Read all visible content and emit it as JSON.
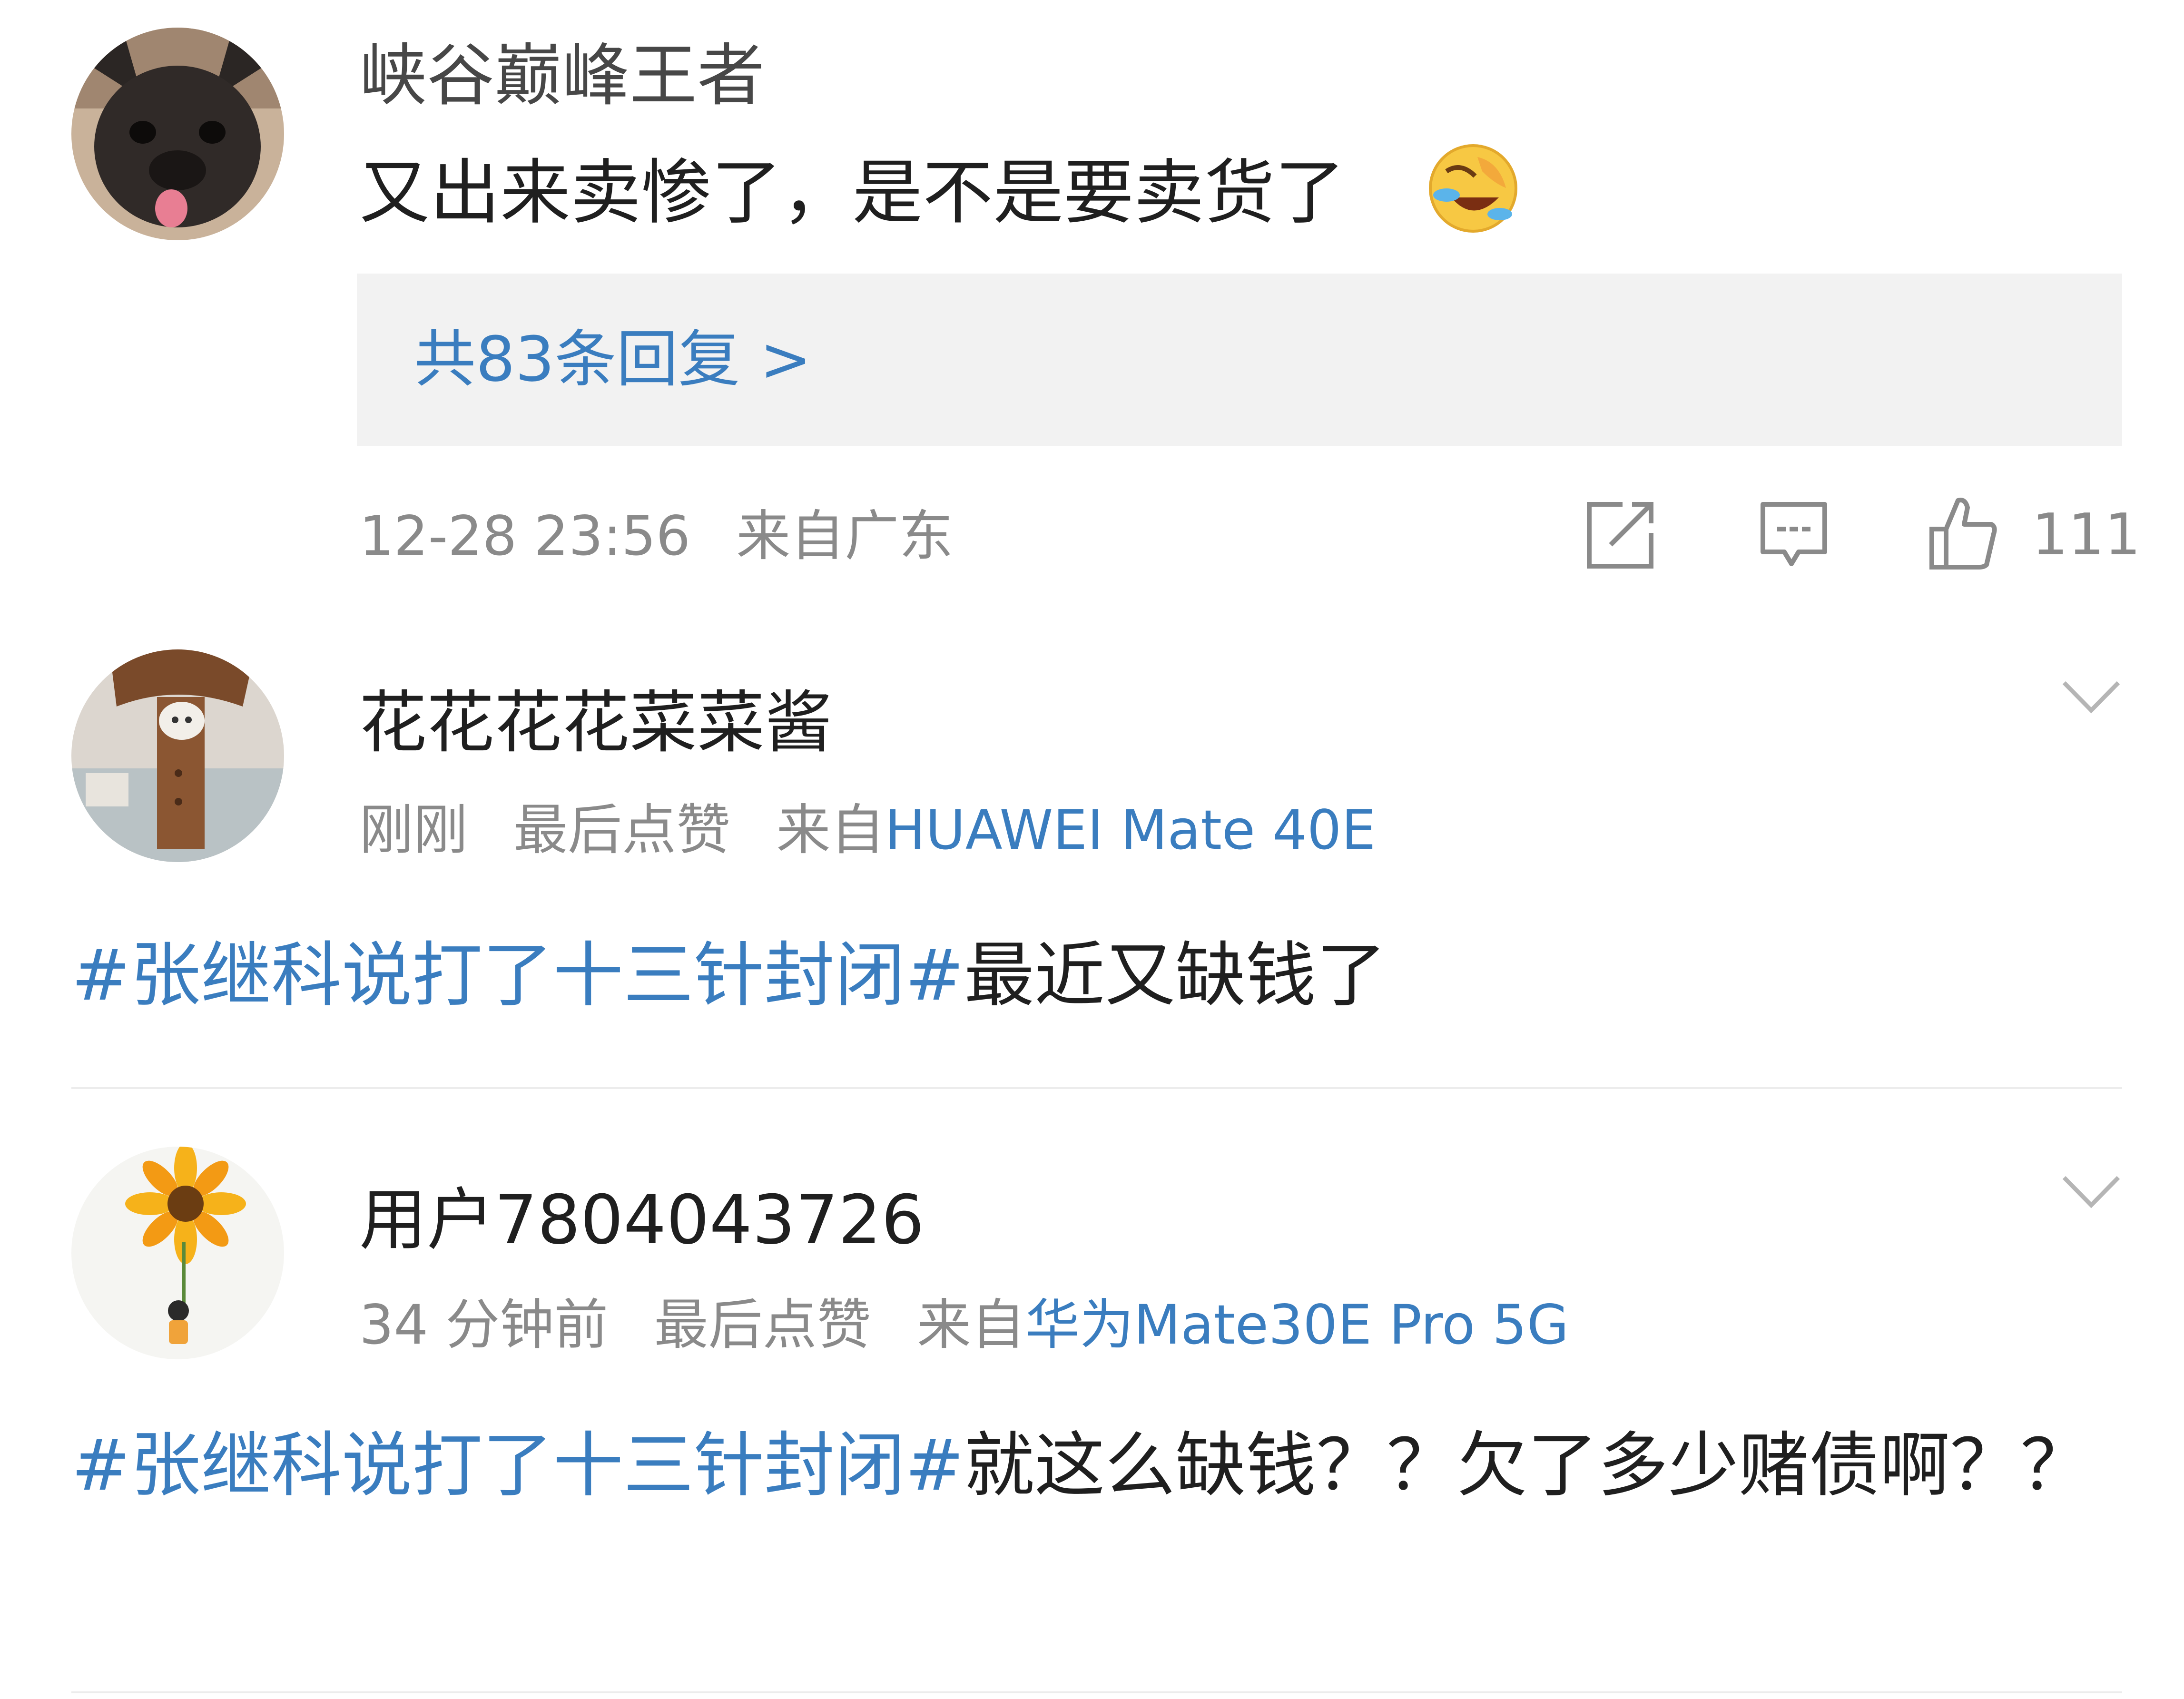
{
  "comments": [
    {
      "username": "峡谷巅峰王者",
      "avatar": "french-bulldog-photo",
      "text": "又出来卖惨了，是不是要卖货了",
      "emoji": "laughing-crying-emoji",
      "replies_label": "共83条回复 >",
      "time": "12-28 23:56",
      "location": "来自广东",
      "icons": [
        "share-icon",
        "comment-icon",
        "like-icon"
      ],
      "like_count": "111"
    },
    {
      "username": "花花花花菜菜酱",
      "avatar": "cat-on-chair-photo",
      "time": "刚刚",
      "last_liked": "最后点赞",
      "from_label": "来自",
      "device": "HUAWEI Mate 40E",
      "topic": "#张继科说打了十三针封闭#",
      "text": "最近又缺钱了",
      "menu_icon": "chevron-down-icon"
    },
    {
      "username": "用户7804043726",
      "avatar": "sunflower-illustration",
      "time": "34 分钟前",
      "last_liked": "最后点赞",
      "from_label": "来自",
      "device": "华为Mate30E Pro 5G",
      "topic": "#张继科说打了十三针封闭#",
      "text": "就这么缺钱？？欠了多少赌债啊？？",
      "menu_icon": "chevron-down-icon"
    }
  ],
  "colors": {
    "link": "#3a7dbf",
    "meta": "#8a8a8a",
    "text": "#1f1f1f",
    "reply_bg": "#f2f2f2",
    "divider": "#ececec"
  }
}
